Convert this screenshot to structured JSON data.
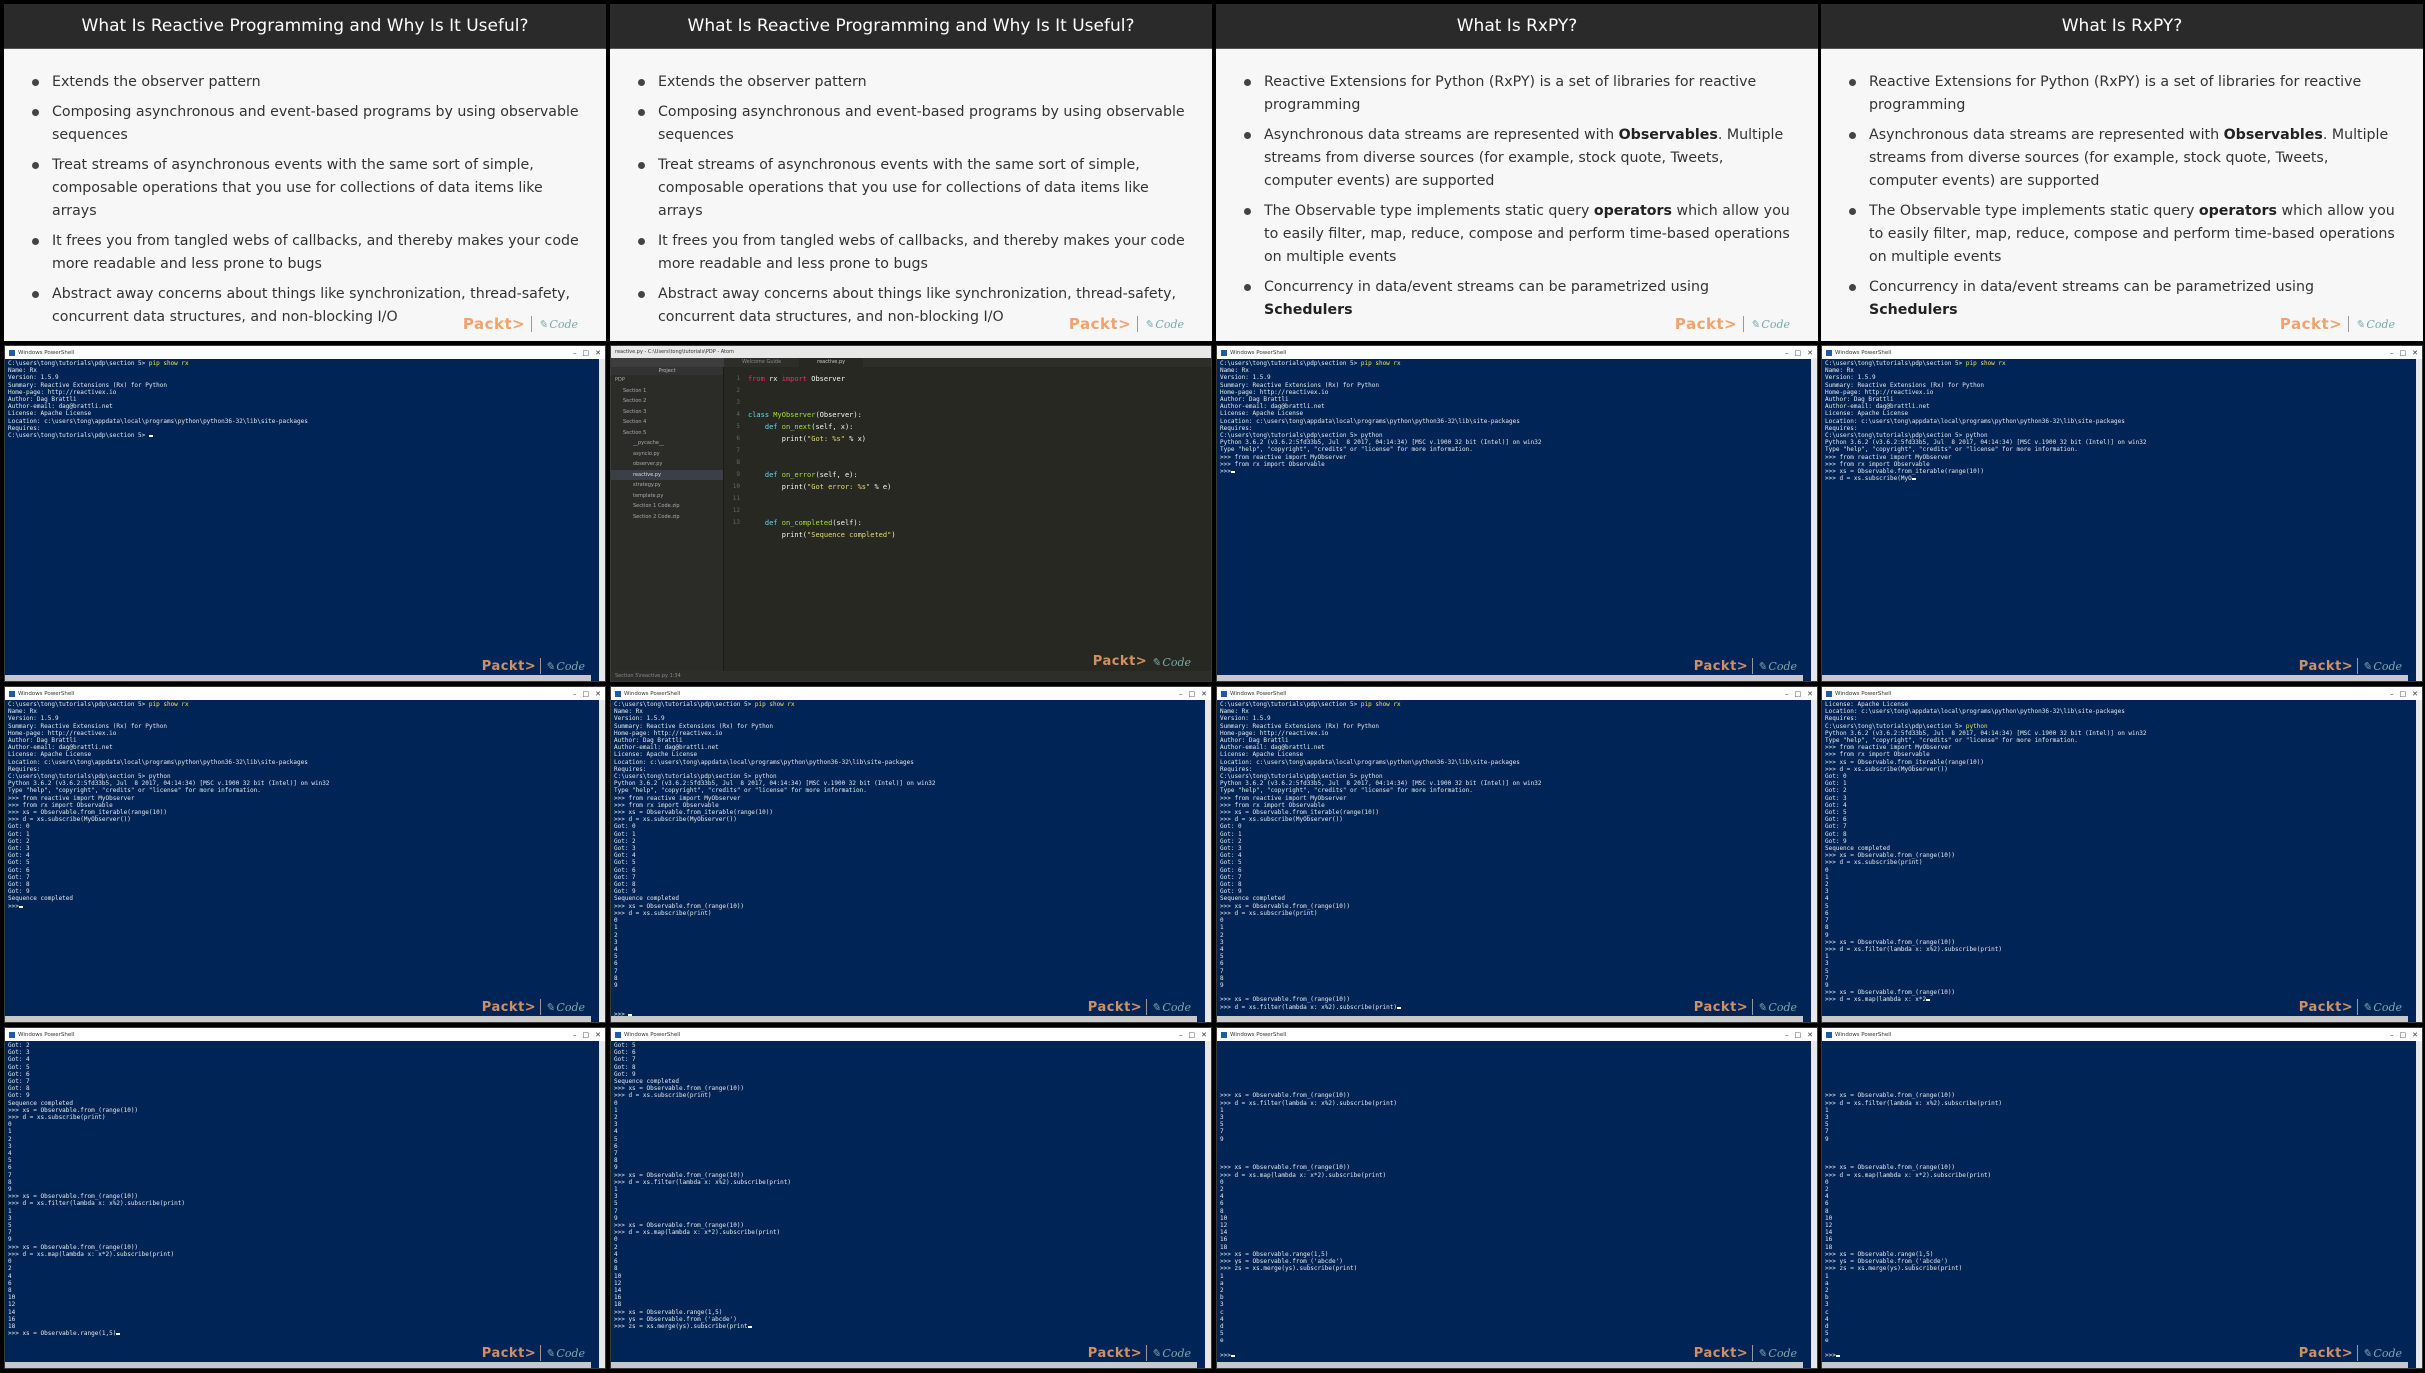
{
  "slides": [
    {
      "title": "What Is Reactive Programming and Why Is It Useful?",
      "bullets": [
        "Extends the observer pattern",
        "Composing asynchronous and event-based programs by using observable sequences",
        "Treat streams of asynchronous events with the same sort of simple, composable operations that you use for collections of data items like arrays",
        "It frees you from tangled webs of callbacks, and thereby makes your code more readable and less prone to bugs",
        "Abstract away concerns about things like synchronization, thread-safety, concurrent data structures, and non-blocking I/O"
      ]
    },
    {
      "title": "What Is RxPY?",
      "bullets": [
        "Reactive Extensions for Python (RxPY) is a set of libraries for reactive programming",
        "Asynchronous data streams are represented with |Observables|. Multiple streams from diverse sources (for example, stock quote, Tweets, computer events) are supported",
        "The Observable type implements static query |operators| which allow you to easily filter, map, reduce, compose and perform time-based operations on multiple events",
        "Concurrency in data/event streams can be parametrized using |Schedulers|"
      ]
    }
  ],
  "logos": {
    "packt": "Packt>",
    "code": "Code"
  },
  "terminal": {
    "window_title": "Windows PowerShell",
    "pip_block": "C:\\users\\tong\\tutorials\\pdp\\section 5> pip show rx\nName: Rx\nVersion: 1.5.9\nSummary: Reactive Extensions (Rx) for Python\nHome-page: http://reactivex.io\nAuthor: Dag Brattli\nAuthor-email: dag@brattli.net\nLicense: Apache License\nLocation: c:\\users\\tong\\appdata\\local\\programs\\python\\python36-32\\lib\\site-packages\nRequires:\nC:\\users\\tong\\tutorials\\pdp\\section 5>",
    "python_header": "Python 3.6.2 (v3.6.2:5fd33b5, Jul  8 2017, 04:14:34) [MSC v.1900 32 bit (Intel)] on win32\nType \"help\", \"copyright\", \"credits\" or \"license\" for more information.",
    "t1_tail": "",
    "t2_tail": ">>> from reactive import MyObserver\n>>> from rx import Observable\n>>>",
    "t3_tail": ">>> from reactive import MyObserver\n>>> from rx import Observable\n>>> xs = Observable.from_iterable(range(10))\n>>> d = xs.subscribe(MyO",
    "t4_tail": ">>> from reactive import MyObserver\n>>> from rx import Observable\n>>> xs = Observable.from_iterable(range(10))\n>>> d = xs.subscribe(MyObserver())\nGot: 0\nGot: 1\nGot: 2\nGot: 3\nGot: 4\nGot: 5\nGot: 6\nGot: 7\nGot: 8\nGot: 9\nSequence completed\n>>>",
    "t5_tail": ">>> from reactive import MyObserver\n>>> from rx import Observable\n>>> xs = Observable.from_iterable(range(10))\n>>> d = xs.subscribe(MyObserver())\nGot: 0\nGot: 1\nGot: 2\nGot: 3\nGot: 4\nGot: 5\nGot: 6\nGot: 7\nGot: 8\nGot: 9\nSequence completed\n>>> xs = Observable.from_(range(10))\n>>> d = xs.subscribe(print)\n0\n1\n2\n3\n4\n5\n6\n7\n8\n9\n\n\n\n>>> ",
    "t6_tail": ">>> from reactive import MyObserver\n>>> from rx import Observable\n>>> xs = Observable.from_iterable(range(10))\n>>> d = xs.subscribe(MyObserver())\nGot: 0\nGot: 1\nGot: 2\nGot: 3\nGot: 4\nGot: 5\nGot: 6\nGot: 7\nGot: 8\nGot: 9\nSequence completed\n>>> xs = Observable.from_(range(10))\n>>> d = xs.subscribe(print)\n0\n1\n2\n3\n4\n5\n6\n7\n8\n9\n\n>>> xs = Observable.from_(range(10))\n>>> d = xs.filter(lambda x: x%2).subscribe(print)",
    "t7_text": "License: Apache License\nLocation: c:\\users\\tong\\appdata\\local\\programs\\python\\python36-32\\lib\\site-packages\nRequires:\nC:\\users\\tong\\tutorials\\pdp\\section 5> python\nPython 3.6.2 (v3.6.2:5fd33b5, Jul  8 2017, 04:14:34) [MSC v.1900 32 bit (Intel)] on win32\nType \"help\", \"copyright\", \"credits\" or \"license\" for more information.\n>>> from reactive import MyObserver\n>>> from rx import Observable\n>>> xs = Observable.from_iterable(range(10))\n>>> d = xs.subscribe(MyObserver())\nGot: 0\nGot: 1\nGot: 2\nGot: 3\nGot: 4\nGot: 5\nGot: 6\nGot: 7\nGot: 8\nGot: 9\nSequence completed\n>>> xs = Observable.from_(range(10))\n>>> d = xs.subscribe(print)\n0\n1\n2\n3\n4\n5\n6\n7\n8\n9\n>>> xs = Observable.from_(range(10))\n>>> d = xs.filter(lambda x: x%2).subscribe(print)\n1\n3\n5\n7\n9\n>>> xs = Observable.from_(range(10))\n>>> d = xs.map(lambda x: x*2",
    "t8_text": "Got: 2\nGot: 3\nGot: 4\nGot: 5\nGot: 6\nGot: 7\nGot: 8\nGot: 9\nSequence completed\n>>> xs = Observable.from_(range(10))\n>>> d = xs.subscribe(print)\n0\n1\n2\n3\n4\n5\n6\n7\n8\n9\n>>> xs = Observable.from_(range(10))\n>>> d = xs.filter(lambda x: x%2).subscribe(print)\n1\n3\n5\n7\n9\n>>> xs = Observable.from_(range(10))\n>>> d = xs.map(lambda x: x*2).subscribe(print)\n0\n2\n4\n6\n8\n10\n12\n14\n16\n18\n>>> xs = Observable.range(1,5)",
    "t9_text": "Got: 5\nGot: 6\nGot: 7\nGot: 8\nGot: 9\nSequence completed\n>>> xs = Observable.from_(range(10))\n>>> d = xs.subscribe(print)\n0\n1\n2\n3\n4\n5\n6\n7\n8\n9\n>>> xs = Observable.from_(range(10))\n>>> d = xs.filter(lambda x: x%2).subscribe(print)\n1\n3\n5\n7\n9\n>>> xs = Observable.from_(range(10))\n>>> d = xs.map(lambda x: x*2).subscribe(print)\n0\n2\n4\n6\n8\n10\n12\n14\n16\n18\n>>> xs = Observable.range(1,5)\n>>> ys = Observable.from_('abcde')\n>>> zs = xs.merge(ys).subscribe(print",
    "t10_text": "\n\n\n\n\n\n\n>>> xs = Observable.from_(range(10))\n>>> d = xs.filter(lambda x: x%2).subscribe(print)\n1\n3\n5\n7\n9\n\n\n\n>>> xs = Observable.from_(range(10))\n>>> d = xs.map(lambda x: x*2).subscribe(print)\n0\n2\n4\n6\n8\n10\n12\n14\n16\n18\n>>> xs = Observable.range(1,5)\n>>> ys = Observable.from_('abcde')\n>>> zs = xs.merge(ys).subscribe(print)\n1\na\n2\nb\n3\nc\n4\nd\n5\ne\n\n>>>"
  },
  "editor": {
    "title": "reactive.py - C:\\Users\\tong\\tutorials\\PDP - Atom",
    "tabs": [
      "Project",
      "Welcome Guide",
      "reactive.py"
    ],
    "tree": [
      "PDP",
      "Section 1",
      "Section 2",
      "Section 3",
      "Section 4",
      "Section 5",
      "__pycache__",
      "asyncio.py",
      "observer.py",
      "reactive.py",
      "strategy.py",
      "template.py",
      "Section 1 Code.zip",
      "Section 2 Code.zip"
    ],
    "line_numbers": "1\n2\n3\n4\n5\n6\n7\n8\n9\n10\n11\n12\n13",
    "status": "Section 5\\reactive.py  1:34"
  }
}
